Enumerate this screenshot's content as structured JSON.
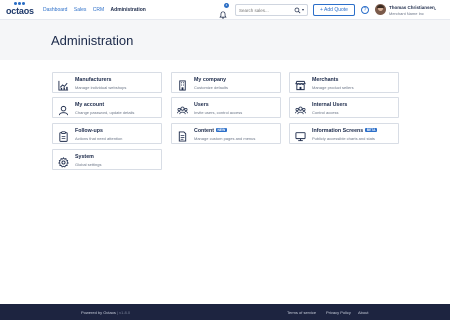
{
  "brand": {
    "name": "octaos"
  },
  "nav": {
    "links": [
      "Dashboard",
      "Sales",
      "CRM",
      "Administration"
    ],
    "active_index": 3
  },
  "notifications": {
    "count": "4"
  },
  "search": {
    "placeholder": "Search sales..."
  },
  "header": {
    "add_quote": "+ Add Quote",
    "help": "?"
  },
  "user": {
    "name": "Thomas Christiansen",
    "company": "Merchant Name Inc"
  },
  "page": {
    "title": "Administration"
  },
  "tiles": [
    {
      "title": "Manufacturers",
      "desc": "Manage individual webshops",
      "icon": "chart-icon"
    },
    {
      "title": "My company",
      "desc": "Customize defaults",
      "icon": "building-icon"
    },
    {
      "title": "Merchants",
      "desc": "Manage product sellers",
      "icon": "store-icon"
    },
    {
      "title": "My account",
      "desc": "Change password, update details",
      "icon": "user-icon"
    },
    {
      "title": "Users",
      "desc": "Invite users, control access",
      "icon": "users-icon"
    },
    {
      "title": "Internal Users",
      "desc": "Control access",
      "icon": "users-icon"
    },
    {
      "title": "Follow-ups",
      "desc": "Actions that need attention",
      "icon": "clipboard-icon"
    },
    {
      "title": "Content",
      "tag": "NEW",
      "desc": "Manage custom pages and menus",
      "icon": "document-icon"
    },
    {
      "title": "Information Screens",
      "tag": "BETA",
      "desc": "Publicly accessible charts and stats",
      "icon": "monitor-icon"
    },
    {
      "title": "System",
      "desc": "Global settings",
      "icon": "gear-icon"
    }
  ],
  "footer": {
    "powered_by": "Powered by Octaos",
    "version": "| v1.8.0",
    "links": [
      "Terms of service",
      "Privacy Policy",
      "About"
    ]
  },
  "colors": {
    "accent": "#2c6fc9",
    "text": "#1c2a4a",
    "footer_bg": "#1d2440",
    "band_bg": "#f5f6f8"
  }
}
